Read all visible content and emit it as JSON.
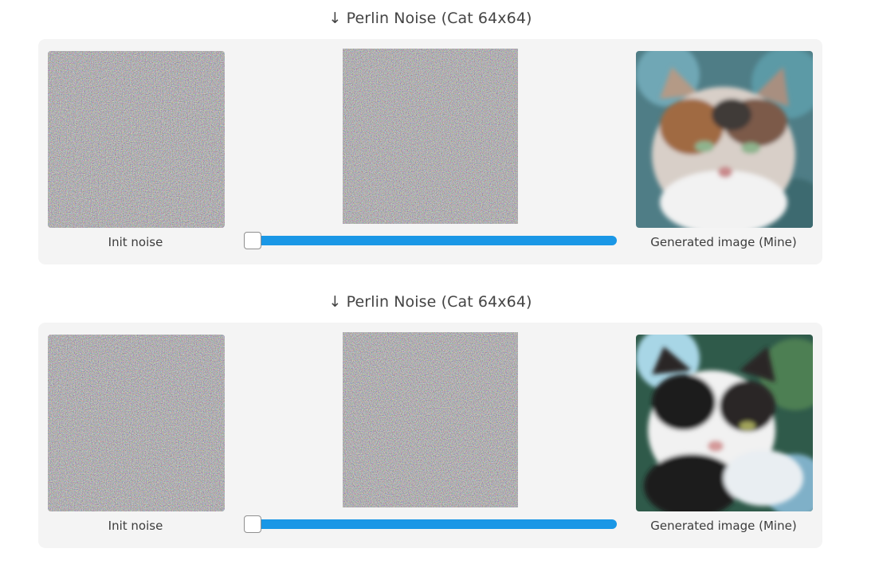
{
  "sections": [
    {
      "title": "↓ Perlin Noise (Cat 64x64)",
      "init_caption": "Init noise",
      "generated_caption": "Generated image (Mine)",
      "slider_value": 0,
      "cat_variant": "calico"
    },
    {
      "title": "↓ Perlin Noise (Cat 64x64)",
      "init_caption": "Init noise",
      "generated_caption": "Generated image (Mine)",
      "slider_value": 0,
      "cat_variant": "black-white"
    }
  ],
  "colors": {
    "panel_bg": "#f4f4f4",
    "slider_fill": "#1a97e6",
    "noise_base": "#7a6f7f"
  },
  "icons": {
    "generated_image": "cat-photo-icon"
  }
}
